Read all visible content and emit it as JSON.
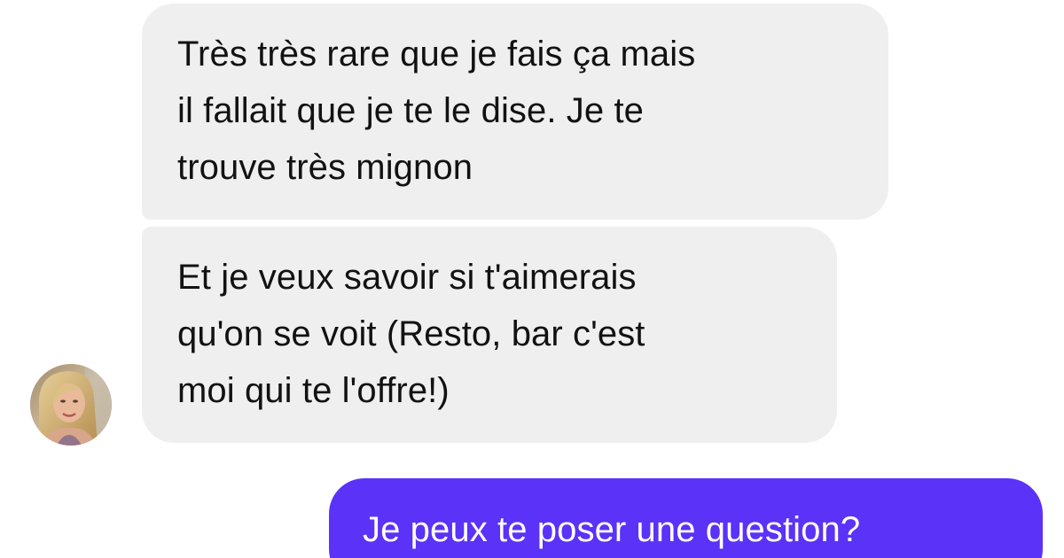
{
  "conversation": {
    "messages": [
      {
        "direction": "incoming",
        "text": "Très très rare que je fais ça mais\nil fallait que je te le dise. Je te\ntrouve très mignon"
      },
      {
        "direction": "incoming",
        "text": "Et je veux savoir si t'aimerais\nqu'on se voit (Resto, bar c'est\nmoi qui te l'offre!)"
      },
      {
        "direction": "outgoing",
        "text": "Je peux te poser une question?"
      }
    ],
    "avatar_icon": "contact-photo",
    "colors": {
      "incoming_bubble": "#efefef",
      "incoming_text": "#121212",
      "outgoing_bubble": "#5b32f7",
      "outgoing_text": "#ffffff",
      "background": "#ffffff"
    }
  }
}
